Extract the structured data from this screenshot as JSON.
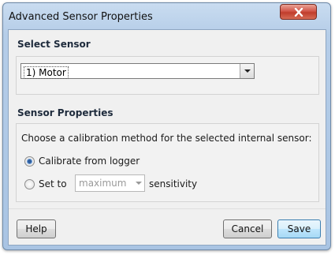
{
  "window": {
    "title": "Advanced Sensor Properties"
  },
  "select_sensor": {
    "heading": "Select Sensor",
    "selected": "1) Motor"
  },
  "sensor_properties": {
    "heading": "Sensor Properties",
    "description": "Choose a calibration method for the selected internal sensor:",
    "options": [
      {
        "label": "Calibrate from logger",
        "checked": true
      },
      {
        "prefix": "Set to",
        "dropdown_value": "maximum",
        "suffix": "sensitivity",
        "checked": false
      }
    ]
  },
  "buttons": {
    "help": "Help",
    "cancel": "Cancel",
    "save": "Save"
  },
  "colors": {
    "titlebar": "#b5cde8",
    "close_button": "#c03d2c",
    "radio_dot": "#2e5d9e",
    "default_button": "#bee6fd"
  }
}
